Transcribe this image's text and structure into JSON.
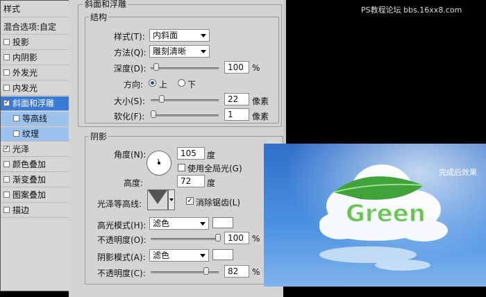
{
  "watermark": "PS教程论坛 bbs.16xx8.com",
  "styles_panel": {
    "title": "样式",
    "blend_options": "混合选项:自定",
    "items": [
      {
        "label": "投影",
        "checked": false
      },
      {
        "label": "内阴影",
        "checked": false
      },
      {
        "label": "外发光",
        "checked": false
      },
      {
        "label": "内发光",
        "checked": false
      },
      {
        "label": "斜面和浮雕",
        "checked": true,
        "selected": true
      },
      {
        "label": "等高线",
        "checked": false,
        "sub": true
      },
      {
        "label": "纹理",
        "checked": false,
        "sub": true
      },
      {
        "label": "光泽",
        "checked": true
      },
      {
        "label": "颜色叠加",
        "checked": false
      },
      {
        "label": "渐变叠加",
        "checked": false
      },
      {
        "label": "图案叠加",
        "checked": false
      },
      {
        "label": "描边",
        "checked": false
      }
    ]
  },
  "dialog": {
    "title": "斜面和浮雕",
    "structure": {
      "legend": "结构",
      "style_label": "样式(T):",
      "style_value": "内斜面",
      "method_label": "方法(Q):",
      "method_value": "雕刻清晰",
      "depth_label": "深度(D):",
      "depth_value": "100",
      "depth_unit": "%",
      "direction_label": "方向:",
      "dir_up": "上",
      "dir_down": "下",
      "size_label": "大小(S):",
      "size_value": "22",
      "size_unit": "像素",
      "soften_label": "软化(F):",
      "soften_value": "1",
      "soften_unit": "像素"
    },
    "shading": {
      "legend": "阴影",
      "angle_label": "角度(N):",
      "angle_value": "105",
      "angle_unit": "度",
      "global_light_label": "使用全局光(G)",
      "altitude_label": "高度:",
      "altitude_value": "72",
      "altitude_unit": "度",
      "gloss_contour_label": "光泽等高线:",
      "antialias_label": "消除锯齿(L)",
      "highlight_mode_label": "高光模式(H):",
      "highlight_mode_value": "滤色",
      "highlight_opacity_label": "不透明度(O):",
      "highlight_opacity_value": "100",
      "highlight_opacity_unit": "%",
      "shadow_mode_label": "阴影模式(A):",
      "shadow_mode_value": "滤色",
      "shadow_opacity_label": "不透明度(C):",
      "shadow_opacity_value": "82",
      "shadow_opacity_unit": "%"
    }
  },
  "preview": {
    "caption": "完成后效果",
    "word": "Green"
  }
}
